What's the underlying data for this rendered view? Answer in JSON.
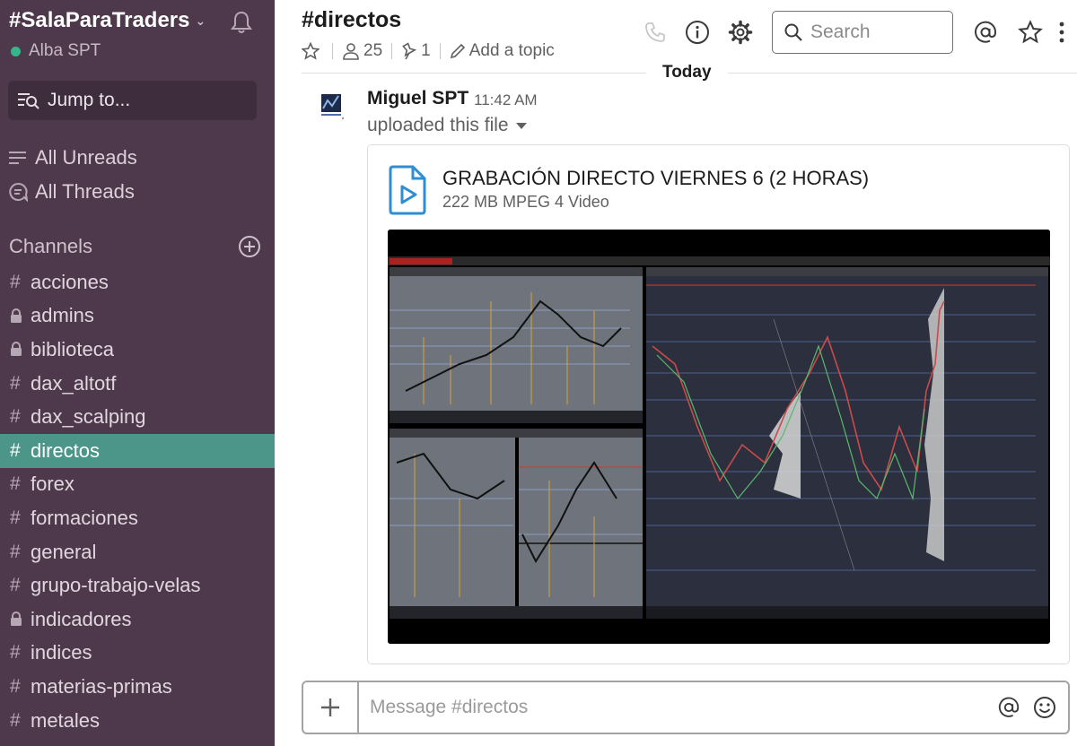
{
  "workspace": {
    "name": "#SalaParaTraders",
    "user": "Alba SPT"
  },
  "jump_to": "Jump to...",
  "nav": {
    "unreads": "All Unreads",
    "threads": "All Threads"
  },
  "channels_header": "Channels",
  "channels": [
    {
      "name": "acciones",
      "prefix": "#",
      "locked": false
    },
    {
      "name": "admins",
      "prefix": "lock",
      "locked": true
    },
    {
      "name": "biblioteca",
      "prefix": "lock",
      "locked": true
    },
    {
      "name": "dax_altotf",
      "prefix": "#",
      "locked": false
    },
    {
      "name": "dax_scalping",
      "prefix": "#",
      "locked": false
    },
    {
      "name": "directos",
      "prefix": "#",
      "locked": false,
      "active": true
    },
    {
      "name": "forex",
      "prefix": "#",
      "locked": false
    },
    {
      "name": "formaciones",
      "prefix": "#",
      "locked": false
    },
    {
      "name": "general",
      "prefix": "#",
      "locked": false
    },
    {
      "name": "grupo-trabajo-velas",
      "prefix": "#",
      "locked": false
    },
    {
      "name": "indicadores",
      "prefix": "lock",
      "locked": true
    },
    {
      "name": "indices",
      "prefix": "#",
      "locked": false
    },
    {
      "name": "materias-primas",
      "prefix": "#",
      "locked": false
    },
    {
      "name": "metales",
      "prefix": "#",
      "locked": false
    }
  ],
  "header": {
    "channel_title": "#directos",
    "members": "25",
    "pins": "1",
    "add_topic": "Add a topic",
    "search_placeholder": "Search"
  },
  "today_label": "Today",
  "message": {
    "sender": "Miguel SPT",
    "time": "11:42 AM",
    "action": "uploaded this file",
    "file": {
      "name": "GRABACIÓN DIRECTO VIERNES 6 (2 HORAS)",
      "meta": "222 MB MPEG 4 Video"
    }
  },
  "composer": {
    "placeholder": "Message #directos"
  },
  "colors": {
    "sidebar": "#4d394b",
    "active": "#4c9689",
    "presence": "#38b48b",
    "file_icon": "#2f8dd4"
  }
}
